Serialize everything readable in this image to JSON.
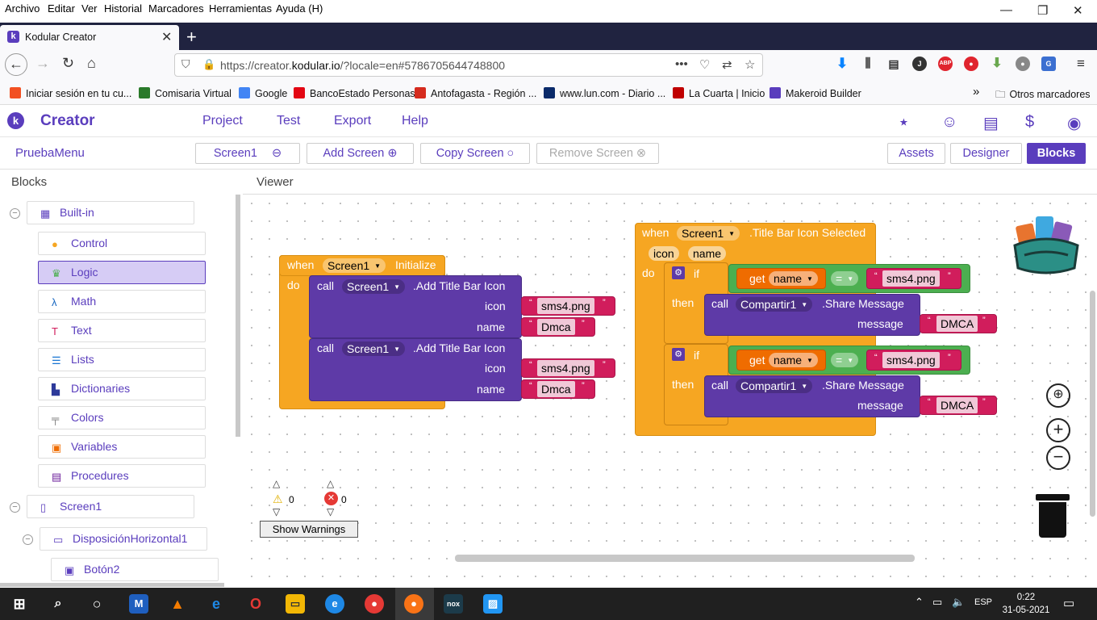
{
  "browser": {
    "menu": [
      "Archivo",
      "Editar",
      "Ver",
      "Historial",
      "Marcadores",
      "Herramientas",
      "Ayuda (H)"
    ],
    "tab_title": "Kodular Creator",
    "url_prefix": "https://creator.",
    "url_domain": "kodular.io",
    "url_suffix": "/?locale=en#5786705644748800",
    "bookmarks": [
      {
        "label": "Iniciar sesión en tu cu...",
        "color": "#f25022"
      },
      {
        "label": "Comisaria Virtual",
        "color": "#2a7a2a"
      },
      {
        "label": "Google",
        "color": "#4285f4"
      },
      {
        "label": "BancoEstado Personas",
        "color": "#e30613"
      },
      {
        "label": "Antofagasta - Región ...",
        "color": "#d52b1e"
      },
      {
        "label": "www.lun.com - Diario ...",
        "color": "#0a2a6a"
      },
      {
        "label": "La Cuarta | Inicio",
        "color": "#c00000"
      },
      {
        "label": "Makeroid Builder",
        "color": "#5a3dbd"
      }
    ],
    "other_bookmarks": "Otros marcadores"
  },
  "kodular": {
    "brand": "Creator",
    "menu": [
      "Project",
      "Test",
      "Export",
      "Help"
    ],
    "project_name": "PruebaMenu",
    "screen_select": "Screen1",
    "add_screen": "Add Screen",
    "copy_screen": "Copy Screen",
    "remove_screen": "Remove Screen",
    "assets": "Assets",
    "designer": "Designer",
    "blocks": "Blocks",
    "blocks_title": "Blocks",
    "viewer_title": "Viewer"
  },
  "tree": {
    "builtin": "Built-in",
    "items": [
      {
        "label": "Control",
        "icon": "control-icon",
        "color": "#f6a622"
      },
      {
        "label": "Logic",
        "icon": "logic-icon",
        "color": "#4caf50"
      },
      {
        "label": "Math",
        "icon": "math-icon",
        "color": "#1565c0"
      },
      {
        "label": "Text",
        "icon": "text-icon",
        "color": "#d11d5c"
      },
      {
        "label": "Lists",
        "icon": "lists-icon",
        "color": "#1976d2"
      },
      {
        "label": "Dictionaries",
        "icon": "dictionaries-icon",
        "color": "#2d3a9a"
      },
      {
        "label": "Colors",
        "icon": "colors-icon",
        "color": "#777"
      },
      {
        "label": "Variables",
        "icon": "variables-icon",
        "color": "#ef6c00"
      },
      {
        "label": "Procedures",
        "icon": "procedures-icon",
        "color": "#6a1b9a"
      }
    ],
    "screen": "Screen1",
    "arrangement": "DisposiciónHorizontal1",
    "button": "Botón2"
  },
  "block1": {
    "when": "when",
    "component": "Screen1",
    "event": "Initialize",
    "do": "do",
    "call": "call",
    "method": ".Add Title Bar Icon",
    "icon_label": "icon",
    "name_label": "name",
    "icon_value": "sms4.png",
    "name_value": "Dmca"
  },
  "block2": {
    "when": "when",
    "component": "Screen1",
    "event": ".Title Bar Icon Selected",
    "param1": "icon",
    "param2": "name",
    "do": "do",
    "if": "if",
    "get": "get",
    "var": "name",
    "op": "=",
    "compare": "sms4.png",
    "then": "then",
    "call": "call",
    "target": "Compartir1",
    "method": ".Share Message",
    "message_label": "message",
    "message_value": "DMCA"
  },
  "warnings": {
    "warn_count": "0",
    "error_count": "0",
    "button": "Show Warnings"
  },
  "taskbar": {
    "lang": "ESP",
    "time": "0:22",
    "date": "31-05-2021"
  }
}
